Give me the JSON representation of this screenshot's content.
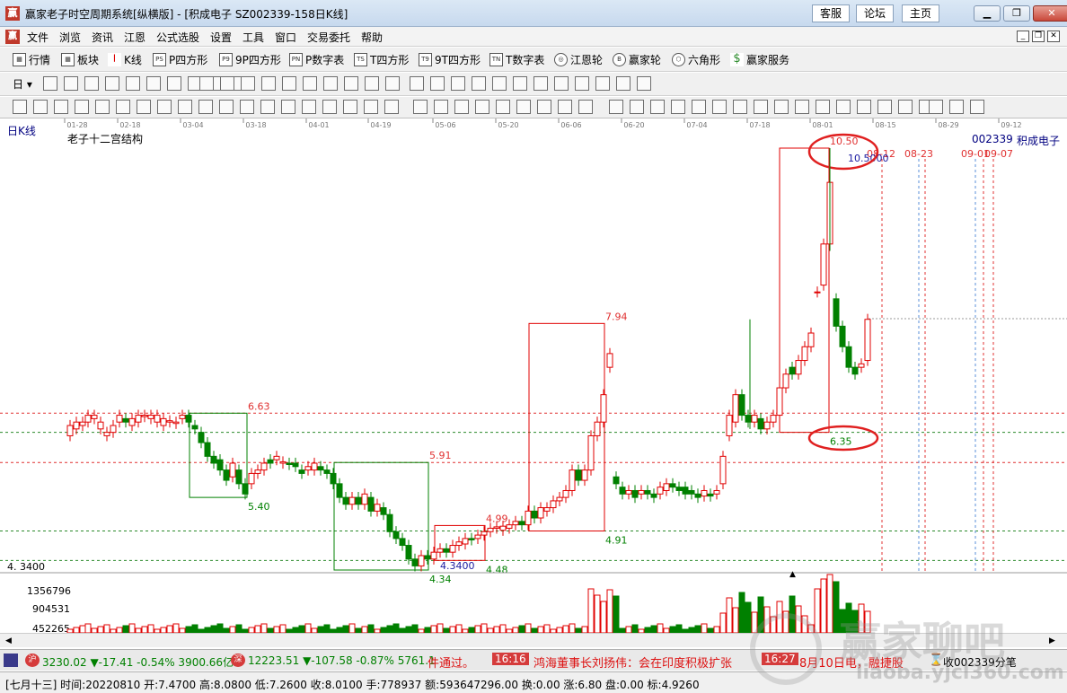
{
  "window": {
    "title": "赢家老子时空周期系统[纵横版] - [积成电子  SZ002339-158日K线]",
    "buttons": [
      "客服",
      "论坛",
      "主页"
    ]
  },
  "menu": {
    "items": [
      "文件",
      "浏览",
      "资讯",
      "江恩",
      "公式选股",
      "设置",
      "工具",
      "窗口",
      "交易委托",
      "帮助"
    ]
  },
  "toolbar": {
    "items": [
      "行情",
      "板块",
      "K线",
      "P四方形",
      "9P四方形",
      "P数字表",
      "T四方形",
      "9T四方形",
      "T数字表",
      "江恩轮",
      "赢家轮",
      "六角形",
      "赢家服务"
    ],
    "icons": [
      "ts-badge",
      "p-badge",
      "9p-badge",
      "pn-badge",
      "t-badge",
      "9t-badge",
      "tn-badge",
      "gann-wheel-icon",
      "big-wheel-icon",
      "hexagon-icon",
      "dollar-icon"
    ],
    "period_dropdown": "日"
  },
  "chart": {
    "period_label": "日K线",
    "indicator_label": "老子十二宫结构",
    "stock_code": "002339",
    "stock_name": "积成电子",
    "date_axis": [
      "01-28",
      "02-18",
      "03-04",
      "03-18",
      "04-01",
      "04-19",
      "05-06",
      "05-20",
      "06-06",
      "06-20",
      "07-04",
      "07-18",
      "08-01",
      "08-15",
      "08-29",
      "09-12"
    ],
    "box_labels": {
      "b1_high": "6.63",
      "b1_low": "5.40",
      "b2_high": "5.91",
      "b2_low": "4.34",
      "b3_high": "4.99",
      "b3_low": "4.48",
      "b4_high": "7.94",
      "b4_low": "4.91",
      "b5_high": "10.50",
      "b5_low": "6.35"
    },
    "low_marker": "4.3400",
    "high_marker": "10.5000",
    "y_low_label": "4. 3400",
    "date_markers": [
      "08-12",
      "08-23",
      "09-01",
      "09-07"
    ],
    "volume_axis": [
      "1356796",
      "904531",
      "452265"
    ]
  },
  "status": {
    "sh_index": "3230.02 ▼-17.41 -0.54% 3900.66亿",
    "sz_index": "12223.51 ▼-107.58 -0.87% 5761.1",
    "news1": "件通过。",
    "news_time1": "16:16",
    "news2": "鸿海董事长刘扬伟：会在印度积极扩张",
    "news_time2": "16:27",
    "news3": "8月10日电，融捷股",
    "right_label": "收002339分笔"
  },
  "bottom": {
    "info": "[七月十三] 时间:20220810 开:7.4700 高:8.0800 低:7.2600 收:8.0100 手:778937 额:593647296.00 换:0.00 涨:6.80 盘:0.00 标:4.9260"
  },
  "watermark": {
    "main": "赢家聊吧",
    "sub": "liaoba.yjcl360.com"
  },
  "colors": {
    "up": "#e00000",
    "down": "#008000",
    "grid_red": "#e03030",
    "grid_green": "#2a8a2a",
    "circle": "#e02020"
  }
}
